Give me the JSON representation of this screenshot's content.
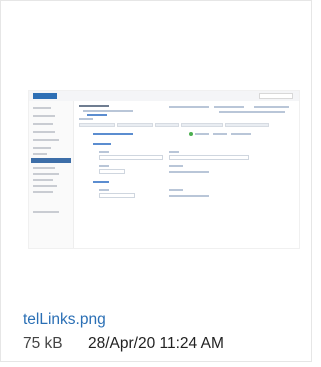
{
  "attachment": {
    "filename": "telLinks.png",
    "size": "75 kB",
    "date": "28/Apr/20 11:24 AM"
  },
  "colors": {
    "link": "#2a6fb5",
    "meta_text": "#333333",
    "card_border": "#e6e6e6"
  }
}
